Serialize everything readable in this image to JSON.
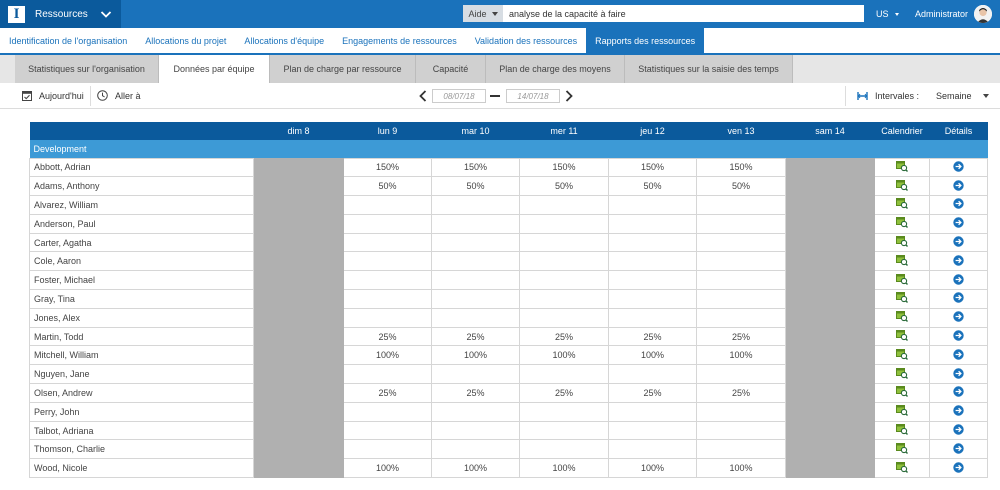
{
  "header": {
    "app_name": "Ressources",
    "logo_letter": "I",
    "help_label": "Aide",
    "search_value": "analyse de la capacité à faire",
    "language": "US",
    "user": "Administrator"
  },
  "nav": {
    "items": [
      {
        "label": "Identification de l'organisation",
        "active": false
      },
      {
        "label": "Allocations du projet",
        "active": false
      },
      {
        "label": "Allocations d'équipe",
        "active": false
      },
      {
        "label": "Engagements de ressources",
        "active": false
      },
      {
        "label": "Validation des ressources",
        "active": false
      },
      {
        "label": "Rapports des ressources",
        "active": true
      }
    ]
  },
  "subtabs": {
    "items": [
      {
        "label": "Statistiques sur l'organisation",
        "active": false
      },
      {
        "label": "Données par équipe",
        "active": true
      },
      {
        "label": "Plan de charge par ressource",
        "active": false
      },
      {
        "label": "Capacité",
        "active": false
      },
      {
        "label": "Plan de charge des moyens",
        "active": false
      },
      {
        "label": "Statistiques sur la saisie des temps",
        "active": false
      }
    ]
  },
  "toolbar": {
    "today_label": "Aujourd'hui",
    "goto_label": "Aller à",
    "date_from": "08/07/18",
    "date_to": "14/07/18",
    "intervals_label": "Intervales :",
    "interval_value": "Semaine"
  },
  "table": {
    "columns": [
      "",
      "dim 8",
      "lun 9",
      "mar 10",
      "mer 11",
      "jeu 12",
      "ven 13",
      "sam 14",
      "Calendrier",
      "Détails"
    ],
    "group": "Development",
    "rows": [
      {
        "name": "Abbott, Adrian",
        "values": [
          "",
          "150%",
          "150%",
          "150%",
          "150%",
          "150%",
          ""
        ]
      },
      {
        "name": "Adams, Anthony",
        "values": [
          "",
          "50%",
          "50%",
          "50%",
          "50%",
          "50%",
          ""
        ]
      },
      {
        "name": "Alvarez, William",
        "values": [
          "",
          "",
          "",
          "",
          "",
          "",
          ""
        ]
      },
      {
        "name": "Anderson, Paul",
        "values": [
          "",
          "",
          "",
          "",
          "",
          "",
          ""
        ]
      },
      {
        "name": "Carter, Agatha",
        "values": [
          "",
          "",
          "",
          "",
          "",
          "",
          ""
        ]
      },
      {
        "name": "Cole, Aaron",
        "values": [
          "",
          "",
          "",
          "",
          "",
          "",
          ""
        ]
      },
      {
        "name": "Foster, Michael",
        "values": [
          "",
          "",
          "",
          "",
          "",
          "",
          ""
        ]
      },
      {
        "name": "Gray, Tina",
        "values": [
          "",
          "",
          "",
          "",
          "",
          "",
          ""
        ]
      },
      {
        "name": "Jones, Alex",
        "values": [
          "",
          "",
          "",
          "",
          "",
          "",
          ""
        ]
      },
      {
        "name": "Martin, Todd",
        "values": [
          "",
          "25%",
          "25%",
          "25%",
          "25%",
          "25%",
          ""
        ]
      },
      {
        "name": "Mitchell, William",
        "values": [
          "",
          "100%",
          "100%",
          "100%",
          "100%",
          "100%",
          ""
        ]
      },
      {
        "name": "Nguyen, Jane",
        "values": [
          "",
          "",
          "",
          "",
          "",
          "",
          ""
        ]
      },
      {
        "name": "Olsen, Andrew",
        "values": [
          "",
          "25%",
          "25%",
          "25%",
          "25%",
          "25%",
          ""
        ]
      },
      {
        "name": "Perry, John",
        "values": [
          "",
          "",
          "",
          "",
          "",
          "",
          ""
        ]
      },
      {
        "name": "Talbot, Adriana",
        "values": [
          "",
          "",
          "",
          "",
          "",
          "",
          ""
        ]
      },
      {
        "name": "Thomson, Charlie",
        "values": [
          "",
          "",
          "",
          "",
          "",
          "",
          ""
        ]
      },
      {
        "name": "Wood, Nicole",
        "values": [
          "",
          "100%",
          "100%",
          "100%",
          "100%",
          "100%",
          ""
        ]
      }
    ]
  },
  "colors": {
    "brand": "#1a72bb",
    "brand_dark": "#0b5a9c",
    "group_row": "#3d9ad6",
    "weekend": "#b0b0b0"
  },
  "icons": {
    "calendar_row": "calendar-search-icon",
    "details_row": "arrow-right-circle-icon"
  }
}
